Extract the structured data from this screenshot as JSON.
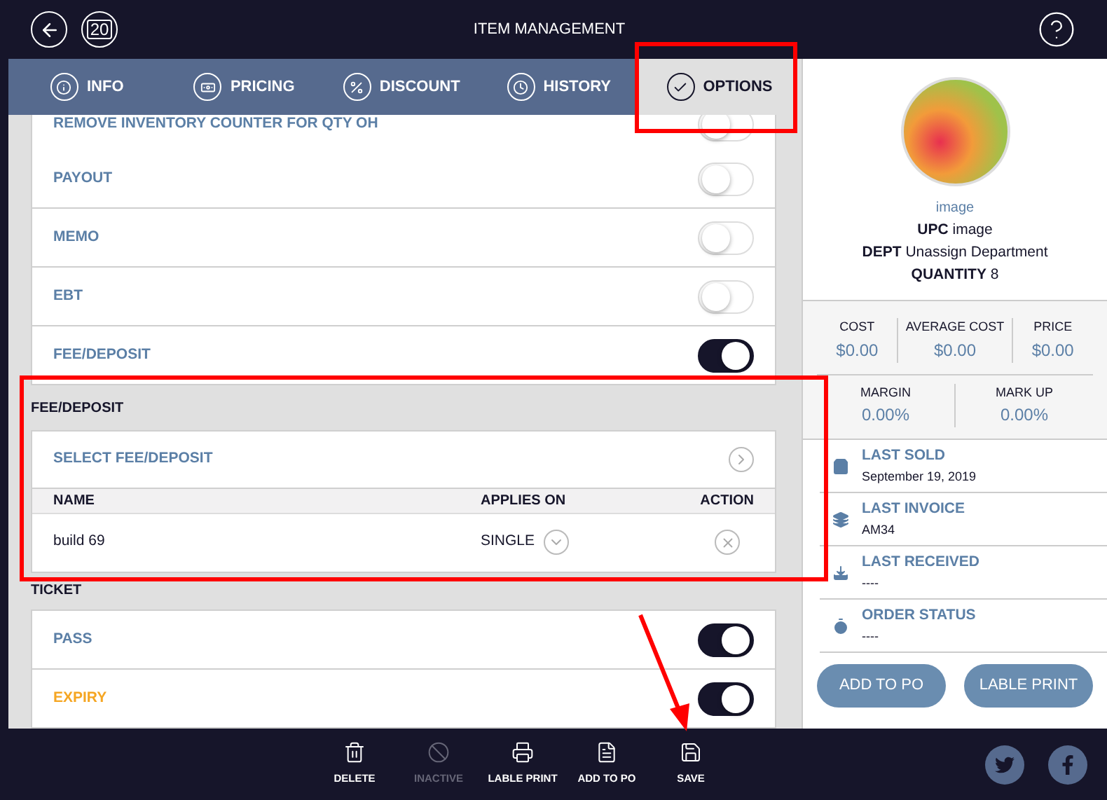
{
  "header": {
    "title": "ITEM MANAGEMENT",
    "date_badge": "20"
  },
  "tabs": [
    {
      "label": "INFO",
      "kind": "info",
      "selected": false
    },
    {
      "label": "PRICING",
      "kind": "pricing",
      "selected": false
    },
    {
      "label": "DISCOUNT",
      "kind": "discount",
      "selected": false
    },
    {
      "label": "HISTORY",
      "kind": "history",
      "selected": false
    },
    {
      "label": "OPTIONS",
      "kind": "options",
      "selected": true
    }
  ],
  "toggles": [
    {
      "label": "REMOVE INVENTORY COUNTER FOR QTY OH",
      "on": false
    },
    {
      "label": "PAYOUT",
      "on": false
    },
    {
      "label": "MEMO",
      "on": false
    },
    {
      "label": "EBT",
      "on": false
    },
    {
      "label": "FEE/DEPOSIT",
      "on": true
    }
  ],
  "fee_deposit": {
    "title": "FEE/DEPOSIT",
    "select_label": "SELECT FEE/DEPOSIT",
    "columns": [
      "NAME",
      "APPLIES ON",
      "ACTION"
    ],
    "rows": [
      {
        "name": "build 69",
        "applies_on": "SINGLE"
      }
    ]
  },
  "ticket": {
    "title": "TICKET",
    "toggles": [
      {
        "label": "PASS",
        "on": true,
        "color": "#5b7fa6"
      },
      {
        "label": "EXPIRY",
        "on": true,
        "color": "#f5a623"
      }
    ]
  },
  "item": {
    "image_label": "image",
    "details": [
      {
        "label": "UPC",
        "value": "image"
      },
      {
        "label": "DEPT",
        "value": "Unassign Department"
      },
      {
        "label": "QUANTITY",
        "value": "8"
      }
    ]
  },
  "prices": [
    {
      "label": "COST",
      "value": "$0.00"
    },
    {
      "label": "AVERAGE COST",
      "value": "$0.00"
    },
    {
      "label": "PRICE",
      "value": "$0.00"
    }
  ],
  "ratios": [
    {
      "label": "MARGIN",
      "value": "0.00%"
    },
    {
      "label": "MARK UP",
      "value": "0.00%"
    }
  ],
  "history": [
    {
      "label": "LAST SOLD",
      "value": "September 19, 2019",
      "kind": "sold"
    },
    {
      "label": "LAST INVOICE",
      "value": "AM34",
      "kind": "invoice"
    },
    {
      "label": "LAST RECEIVED",
      "value": "----",
      "kind": "received"
    },
    {
      "label": "ORDER STATUS",
      "value": "----",
      "kind": "status"
    }
  ],
  "side_buttons": [
    "ADD TO PO",
    "LABLE PRINT"
  ],
  "toolbar": [
    {
      "label": "DELETE",
      "kind": "delete",
      "disabled": false
    },
    {
      "label": "INACTIVE",
      "kind": "inactive",
      "disabled": true
    },
    {
      "label": "LABLE PRINT",
      "kind": "print",
      "disabled": false
    },
    {
      "label": "ADD TO PO",
      "kind": "po",
      "disabled": false
    },
    {
      "label": "SAVE",
      "kind": "save",
      "disabled": false
    }
  ]
}
